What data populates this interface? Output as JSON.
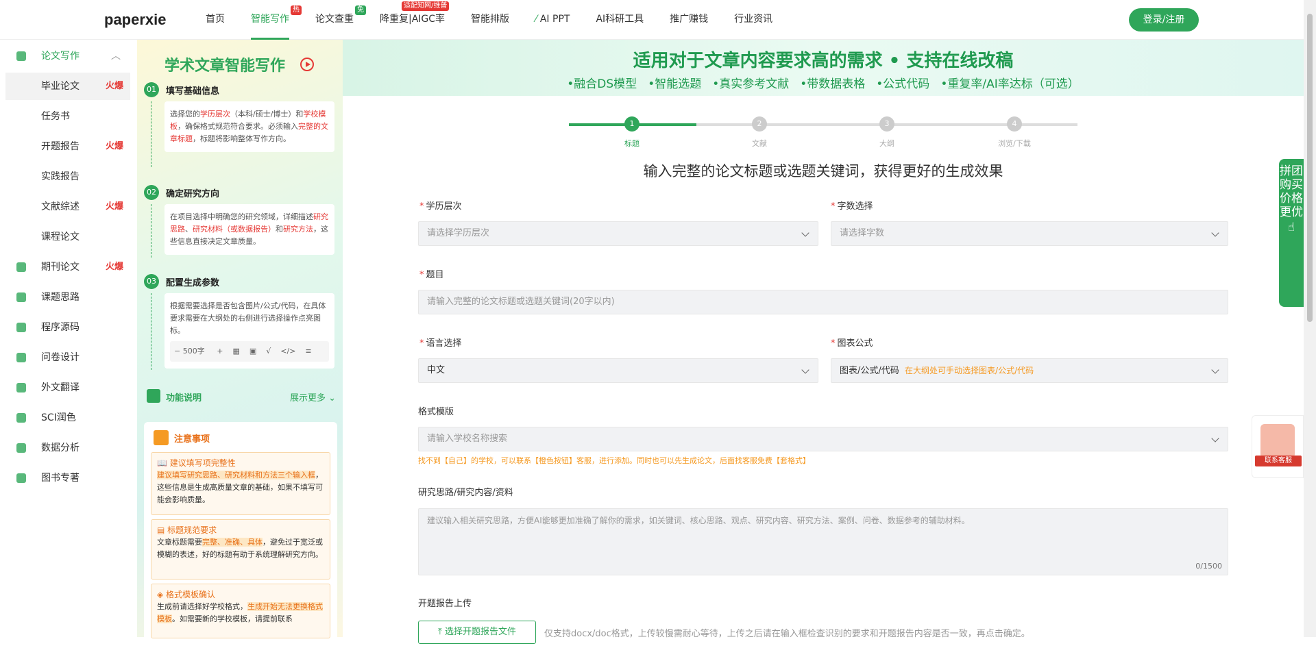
{
  "header": {
    "logo": "paperxie",
    "nav": [
      {
        "label": "首页"
      },
      {
        "label": "智能写作",
        "tag": "热",
        "tag_color": "#e53935",
        "active": true
      },
      {
        "label": "论文查重",
        "tag": "免",
        "tag_color": "#2fa65a"
      },
      {
        "label": "降重复|AIGC率",
        "tag": "适配知网/维普",
        "tag_color": "#e53935"
      },
      {
        "label": "智能排版"
      },
      {
        "label": "AI PPT"
      },
      {
        "label": "AI科研工具"
      },
      {
        "label": "推广赚钱"
      },
      {
        "label": "行业资讯"
      }
    ],
    "login": "登录/注册"
  },
  "sidebar": {
    "group": "论文写作",
    "items": [
      {
        "label": "毕业论文",
        "hot": "火爆",
        "selected": true
      },
      {
        "label": "任务书"
      },
      {
        "label": "开题报告",
        "hot": "火爆"
      },
      {
        "label": "实践报告"
      },
      {
        "label": "文献综述",
        "hot": "火爆"
      },
      {
        "label": "课程论文"
      },
      {
        "label": "期刊论文",
        "hot": "火爆",
        "icon": true
      },
      {
        "label": "课题思路",
        "icon": true
      },
      {
        "label": "程序源码",
        "icon": true
      },
      {
        "label": "问卷设计",
        "icon": true
      },
      {
        "label": "外文翻译",
        "icon": true
      },
      {
        "label": "SCI润色",
        "icon": true
      },
      {
        "label": "数据分析",
        "icon": true
      },
      {
        "label": "图书专著",
        "icon": true
      }
    ]
  },
  "guide": {
    "title": "学术文章智能写作",
    "steps": [
      {
        "num": "01",
        "title": "填写基础信息"
      },
      {
        "num": "02",
        "title": "确定研究方向"
      },
      {
        "num": "03",
        "title": "配置生成参数"
      }
    ],
    "step1": {
      "a": "选择您的",
      "b": "学历层次",
      "c": "（本科/硕士/博士）和",
      "d": "学校模板",
      "e": "，确保格式规范符合要求。必须输入",
      "f": "完整的文章标题",
      "g": "，标题将影响整体写作方向。"
    },
    "step2": {
      "a": "在项目选择中明确您的研究领域，详细描述",
      "b": "研究思路",
      "c": "、",
      "d": "研究材料（或数据报告）",
      "e": "和",
      "f": "研究方法",
      "g": "，这些信息直接决定文章质量。"
    },
    "step3": {
      "a": "根据需要选择是否包含图片/公式/代码，在具体要求需要在大纲处的右侧进行选择操作点亮图标。",
      "words": "500字"
    },
    "func_title": "功能说明",
    "func_more": "展示更多",
    "notice_title": "注意事项",
    "notices": [
      {
        "title": "建议填写项完整性",
        "hl": "建议填写研究思路、研究材料和方法三个输入框",
        "rest": "，这些信息是生成高质量文章的基础，如果不填写可能会影响质量。"
      },
      {
        "title": "标题规范要求",
        "pre": "文章标题需要",
        "hl": "完整、准确、具体",
        "rest": "，避免过于宽泛或模糊的表述，好的标题有助于系统理解研究方向。"
      },
      {
        "title": "格式模板确认",
        "pre": "生成前请选择好学校格式，",
        "hl": "生成开始无法更换格式模板",
        "rest": "。如需要新的学校模板，请提前联系"
      }
    ]
  },
  "banner": {
    "title": "适用对于文章内容要求高的需求 • 支持在线改稿",
    "features": [
      "•融合DS模型",
      "•智能选题",
      "•真实参考文献",
      "•带数据表格",
      "•公式代码",
      "•重复率/AI率达标（可选）"
    ]
  },
  "steps": [
    {
      "num": "1",
      "label": "标题",
      "active": true
    },
    {
      "num": "2",
      "label": "文献"
    },
    {
      "num": "3",
      "label": "大纲"
    },
    {
      "num": "4",
      "label": "浏览/下载"
    }
  ],
  "progress_fraction": 0.25,
  "form": {
    "hint": "输入完整的论文标题或选题关键词，获得更好的生成效果",
    "level_label": "学历层次",
    "level_placeholder": "请选择学历层次",
    "words_label": "字数选择",
    "words_placeholder": "请选择字数",
    "topic_label": "题目",
    "topic_placeholder": "请输入完整的论文标题或选题关键词(20字以内)",
    "lang_label": "语言选择",
    "lang_value": "中文",
    "chart_label": "图表公式",
    "chart_value": "图表/公式/代码",
    "chart_note": "在大纲处可手动选择图表/公式/代码",
    "template_label": "格式模版",
    "template_placeholder": "请输入学校名称搜索",
    "template_tip": "找不到【自己】的学校，可以联系【橙色按钮】客服，进行添加。同时也可以先生成论文，后面找客服免费【套格式】",
    "research_label": "研究思路/研究内容/资料",
    "research_placeholder": "建议输入相关研究思路，方便AI能够更加准确了解你的需求，如关键词、核心思路、观点、研究内容、研究方法、案例、问卷、数据参考的辅助材料。",
    "research_count": "0/1500",
    "upload_label": "开题报告上传",
    "upload_button": "选择开题报告文件",
    "upload_tip": "仅支持docx/doc格式，上传较慢需耐心等待，上传之后请在输入框检查识别的要求和开题报告内容是否一致，再点击确定。"
  },
  "floating": {
    "group_buy": "拼团购买 价格更优",
    "service": "联系客服"
  }
}
